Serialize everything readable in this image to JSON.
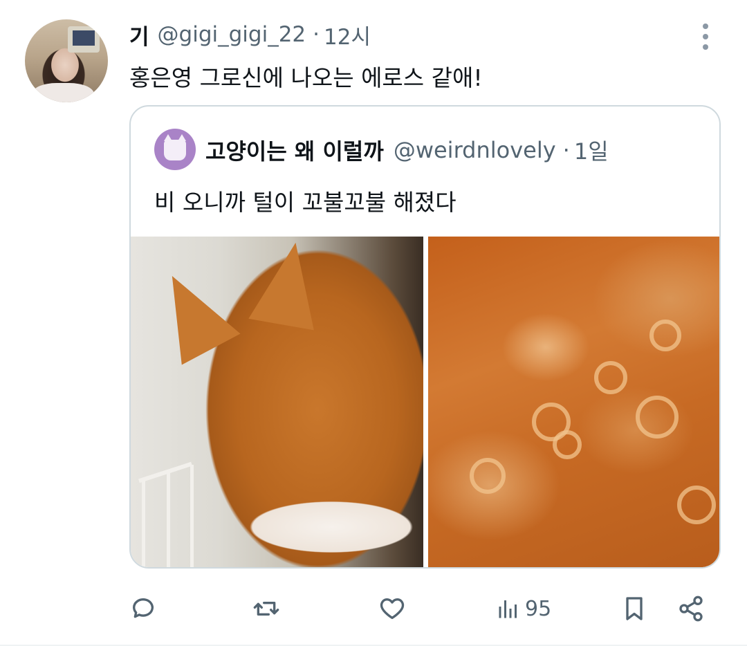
{
  "tweet": {
    "author_name": "기",
    "handle": "@gigi_gigi_22",
    "separator": "·",
    "time": "12시",
    "text": "홍은영 그로신에 나오는 에로스 같애!"
  },
  "quoted": {
    "author_name": "고양이는 왜 이럴까",
    "handle": "@weirdnlovely",
    "separator": "·",
    "time": "1일",
    "text": "비 오니까 털이 꼬불꼬불 해졌다"
  },
  "actions": {
    "views_count": "95"
  },
  "icons": {
    "reply": "reply-icon",
    "retweet": "retweet-icon",
    "like": "heart-icon",
    "views": "views-icon",
    "bookmark": "bookmark-icon",
    "share": "share-icon",
    "more": "more-icon"
  },
  "colors": {
    "text": "#0f1419",
    "secondary": "#536471",
    "border": "#cfd9de"
  }
}
